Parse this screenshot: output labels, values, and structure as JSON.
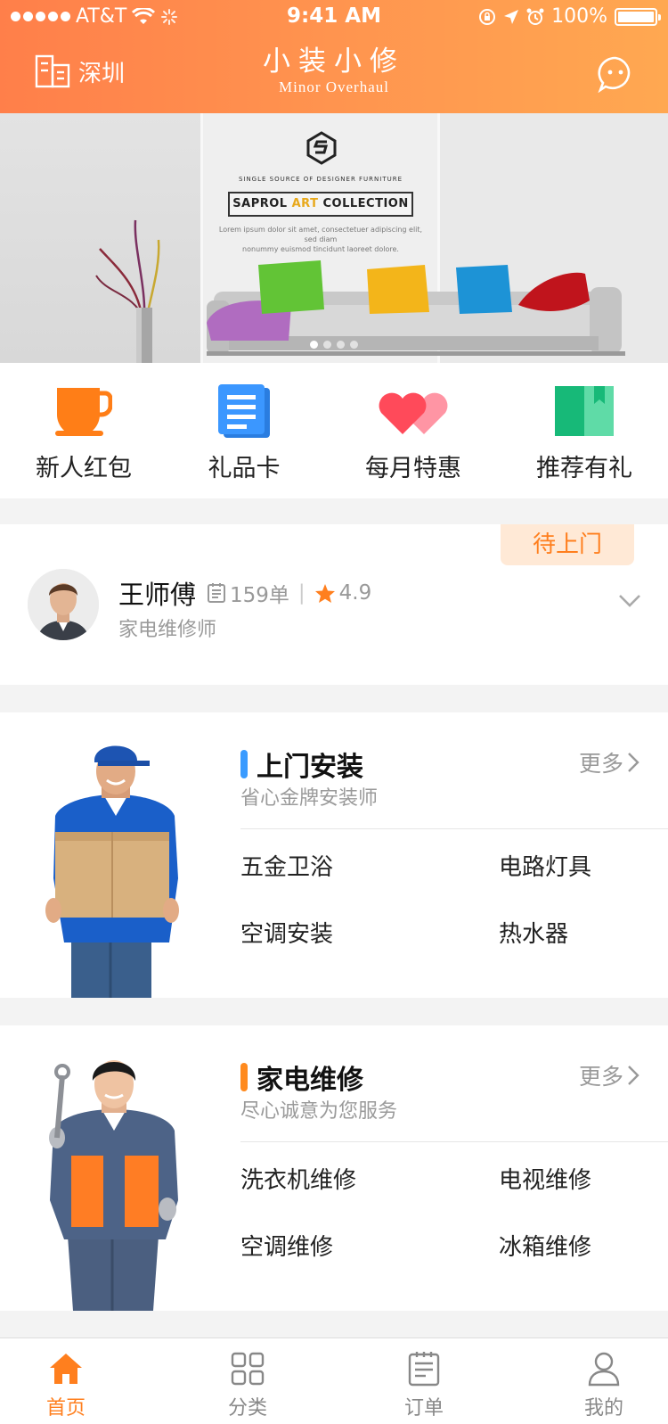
{
  "status_bar": {
    "carrier": "AT&T",
    "time": "9:41 AM",
    "battery": "100%"
  },
  "header": {
    "city": "深圳",
    "title_cn": "小装小修",
    "title_en": "Minor Overhaul"
  },
  "banner": {
    "tagline": "SINGLE SOURCE OF DESIGNER FURNITURE",
    "collection_prefix": "SAPROL ",
    "collection_highlight": "ART",
    "collection_suffix": " COLLECTION",
    "body_line1": "Lorem ipsum dolor sit amet, consectetuer adipiscing elit, sed diam",
    "body_line2": "nonummy euismod tincidunt laoreet dolore.",
    "page_count": 4,
    "active_page": 1
  },
  "quick_menu": [
    {
      "label": "新人红包",
      "icon": "cup-icon"
    },
    {
      "label": "礼品卡",
      "icon": "gift-card-icon"
    },
    {
      "label": "每月特惠",
      "icon": "hearts-icon"
    },
    {
      "label": "推荐有礼",
      "icon": "book-icon"
    }
  ],
  "order": {
    "status_tag": "待上门",
    "master_name": "王师傅",
    "order_count": "159单",
    "rating": "4.9",
    "role": "家电维修师"
  },
  "sections": [
    {
      "title": "上门安装",
      "subtitle": "省心金牌安装师",
      "more": "更多",
      "accent": "#3a9bff",
      "items": [
        "五金卫浴",
        "电路灯具",
        "空调安装",
        "热水器"
      ]
    },
    {
      "title": "家电维修",
      "subtitle": "尽心诚意为您服务",
      "more": "更多",
      "accent": "#ff8a1e",
      "items": [
        "洗衣机维修",
        "电视维修",
        "空调维修",
        "冰箱维修"
      ]
    }
  ],
  "tabbar": [
    {
      "label": "首页",
      "icon": "home-icon",
      "active": true
    },
    {
      "label": "分类",
      "icon": "grid-icon",
      "active": false
    },
    {
      "label": "订单",
      "icon": "order-icon",
      "active": false
    },
    {
      "label": "我的",
      "icon": "user-icon",
      "active": false
    }
  ],
  "colors": {
    "brand_orange": "#ff8a4e",
    "accent_orange": "#ff7f1e",
    "install_blue": "#3a9bff"
  }
}
